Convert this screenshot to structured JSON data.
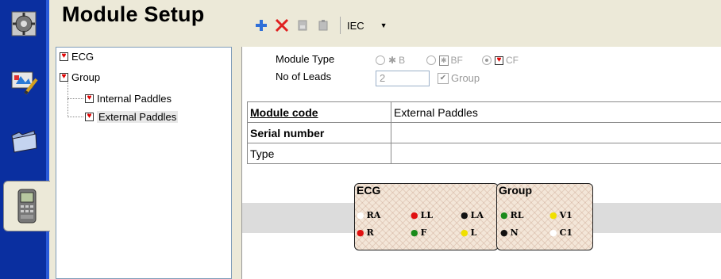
{
  "title": "Module Setup",
  "toolbar": {
    "add_icon": "plus-icon",
    "delete_icon": "x-icon",
    "standard": "IEC",
    "dropdown_icon": "chevron-down-icon"
  },
  "side_tabs": [
    "gear-settings-icon",
    "monitor-edit-icon",
    "folder-icon",
    "device-handset-icon"
  ],
  "tree": {
    "items": [
      {
        "label": "ECG"
      },
      {
        "label": "Group"
      },
      {
        "label": "Internal Paddles"
      },
      {
        "label": "External Paddles"
      }
    ]
  },
  "module": {
    "type_label": "Module Type",
    "type_options": [
      "B",
      "BF",
      "CF"
    ],
    "selected_type": "CF",
    "leads_label": "No of Leads",
    "leads_value": "2",
    "group_label": "Group",
    "group_checked": true
  },
  "properties": [
    {
      "key": "Module code",
      "value": "External Paddles"
    },
    {
      "key": "Serial number",
      "value": ""
    },
    {
      "key": "Type",
      "value": ""
    }
  ],
  "ecg_panel": {
    "title": "ECG",
    "leads": [
      {
        "label": "RA",
        "color": "#ffffff"
      },
      {
        "label": "LL",
        "color": "#e01010"
      },
      {
        "label": "LA",
        "color": "#111111"
      },
      {
        "label": "R",
        "color": "#e01010"
      },
      {
        "label": "F",
        "color": "#1a8a1a"
      },
      {
        "label": "L",
        "color": "#f0e000"
      }
    ]
  },
  "group_panel": {
    "title": "Group",
    "leads": [
      {
        "label": "RL",
        "color": "#1a8a1a"
      },
      {
        "label": "V1",
        "color": "#f0e000"
      },
      {
        "label": "N",
        "color": "#111111"
      },
      {
        "label": "C1",
        "color": "#ffffff"
      }
    ]
  }
}
